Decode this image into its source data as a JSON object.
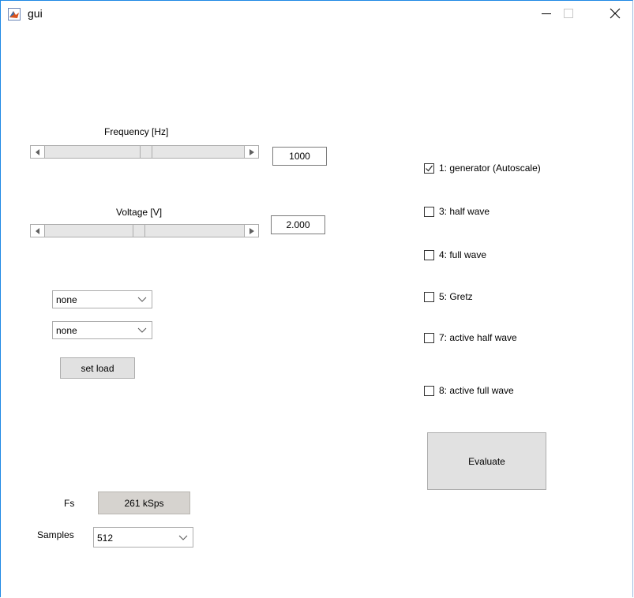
{
  "window": {
    "title": "gui"
  },
  "frequency": {
    "label": "Frequency [Hz]",
    "value": "1000",
    "slider_fraction": 0.51
  },
  "voltage": {
    "label": "Voltage [V]",
    "value": "2.000",
    "slider_fraction": 0.47
  },
  "load": {
    "dropdown1": "none",
    "dropdown2": "none",
    "set_label": "set load"
  },
  "fs": {
    "label": "Fs",
    "value": "261 kSps"
  },
  "samples": {
    "label": "Samples",
    "value": "512"
  },
  "checks": [
    {
      "label": "1: generator (Autoscale)",
      "checked": true
    },
    {
      "label": "3: half wave",
      "checked": false
    },
    {
      "label": "4: full wave",
      "checked": false
    },
    {
      "label": "5: Gretz",
      "checked": false
    },
    {
      "label": "7: active half wave",
      "checked": false
    },
    {
      "label": "8: active full wave",
      "checked": false
    }
  ],
  "evaluate_label": "Evaluate"
}
